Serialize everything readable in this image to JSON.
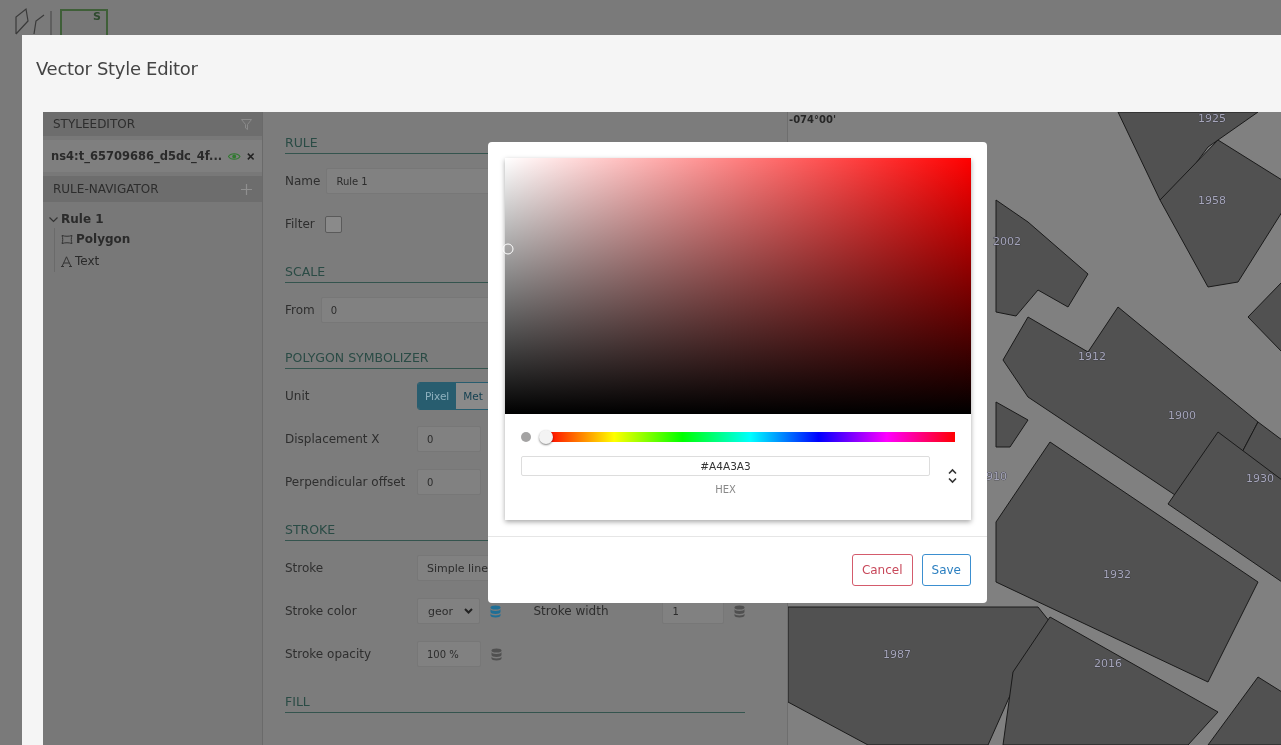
{
  "app": {
    "logo_letter": "S"
  },
  "window": {
    "title": "Vector Style Editor"
  },
  "sidebar": {
    "header": "STYLEEDITOR",
    "layer": {
      "name": "ns4:t_65709686_d5dc_4f...",
      "visible": true
    },
    "navigator_header": "RULE-NAVIGATOR",
    "rules": [
      {
        "label": "Rule 1",
        "expanded": true,
        "children": [
          {
            "label": "Polygon",
            "kind": "polygon"
          },
          {
            "label": "Text",
            "kind": "text"
          }
        ]
      }
    ]
  },
  "form": {
    "sections": [
      {
        "heading": "RULE",
        "kind": "inline",
        "fields": [
          {
            "kind": "text",
            "label": "Name",
            "value": "Rule 1"
          },
          {
            "kind": "checkbox",
            "label": "Filter",
            "checked": false
          }
        ]
      },
      {
        "heading": "SCALE",
        "kind": "inline",
        "fields": [
          {
            "kind": "text",
            "label": "From",
            "value": "0"
          }
        ]
      },
      {
        "heading": "POLYGON SYMBOLIZER",
        "kind": "grid",
        "fields": [
          {
            "kind": "toggle",
            "label": "Unit",
            "options": [
              {
                "label": "Pixel",
                "selected": true
              },
              {
                "label": "Met",
                "selected": false
              }
            ]
          },
          {
            "kind": "number",
            "label": "Displacement X",
            "value": "0"
          },
          {
            "kind": "number",
            "label": "Perpendicular offset",
            "value": "0"
          }
        ]
      },
      {
        "heading": "STROKE",
        "kind": "grid",
        "fields": [
          {
            "kind": "wideselect",
            "label": "Stroke",
            "value": "Simple line"
          },
          {
            "kind": "select",
            "label": "Stroke color",
            "value": "geor",
            "linked": true,
            "extra": {
              "label": "Stroke width",
              "value": "1",
              "linked": false
            }
          },
          {
            "kind": "number",
            "label": "Stroke opacity",
            "value": "100 %",
            "linked": false
          }
        ]
      },
      {
        "heading": "FILL",
        "kind": "grid"
      }
    ]
  },
  "map": {
    "coordinate": "-074°00'",
    "labels": [
      "1925",
      "1958",
      "2002",
      "1912",
      "1900",
      "910",
      "1930",
      "1932",
      "1987",
      "2016"
    ]
  },
  "color_picker": {
    "hue": {
      "level": 0
    },
    "hex": "#A4A3A3",
    "format_label": "HEX",
    "buttons": [
      {
        "label": "Cancel",
        "kind": "cancel"
      },
      {
        "label": "Save",
        "kind": "save"
      }
    ]
  }
}
